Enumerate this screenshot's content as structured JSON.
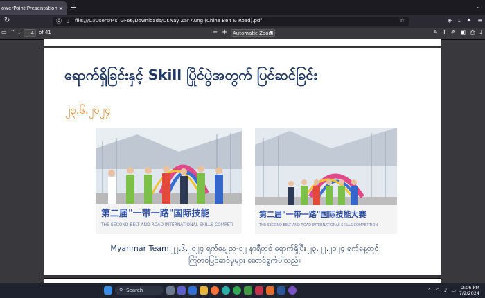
{
  "browser": {
    "tab_title": "owerPoint Presentation – Dr.Nay",
    "tab_close": "✕",
    "new_tab": "+",
    "url": "file:///C:/Users/Msi GF66/Downloads/Dr.Nay Zar Aung (China Belt & Road).pdf"
  },
  "pdf_toolbar": {
    "page_number": "4",
    "page_count": "of 41",
    "zoom": "Automatic Zoom"
  },
  "slide": {
    "title": "ရောက်ရှိခြင်းနှင့် Skill ပြိုင်ပွဲအတွက် ပြင်ဆင်ခြင်း",
    "date": "၂၃.၆.၂၀၂၄",
    "caption_line1": "Myanmar Team ၂၂.၆.၂၀၂၄ ရက်နေ့ ည-၁၂ နာရီတွင် ရောက်ရှိပြီး ၂၃.၂၂.၂၀၂၄ ရက်နေ့တွင်",
    "caption_line2": "ကြိုတင်ပြင်ဆင်မှုများ ဆောင်ရွက်ပါသည်။",
    "photo1_banner": "第二届\"一带一路\"国际技能",
    "photo1_banner_en": "THE SECOND BELT AND ROAD INTERNATIONAL SKILLS COMPETI",
    "photo2_banner": "第二届\"一带一路\"国际技能大赛",
    "photo2_banner_en": "THE SECOND BELT AND ROAD INTERNATIONAL SKILLS COMPETITION"
  },
  "taskbar": {
    "search_label": "Search",
    "time": "2:06 PM",
    "date": "7/2/2024"
  },
  "colors": {
    "title": "#1f3864",
    "date": "#f08a24",
    "tab_bg": "#42414d",
    "taskbar": "#1f2330"
  }
}
